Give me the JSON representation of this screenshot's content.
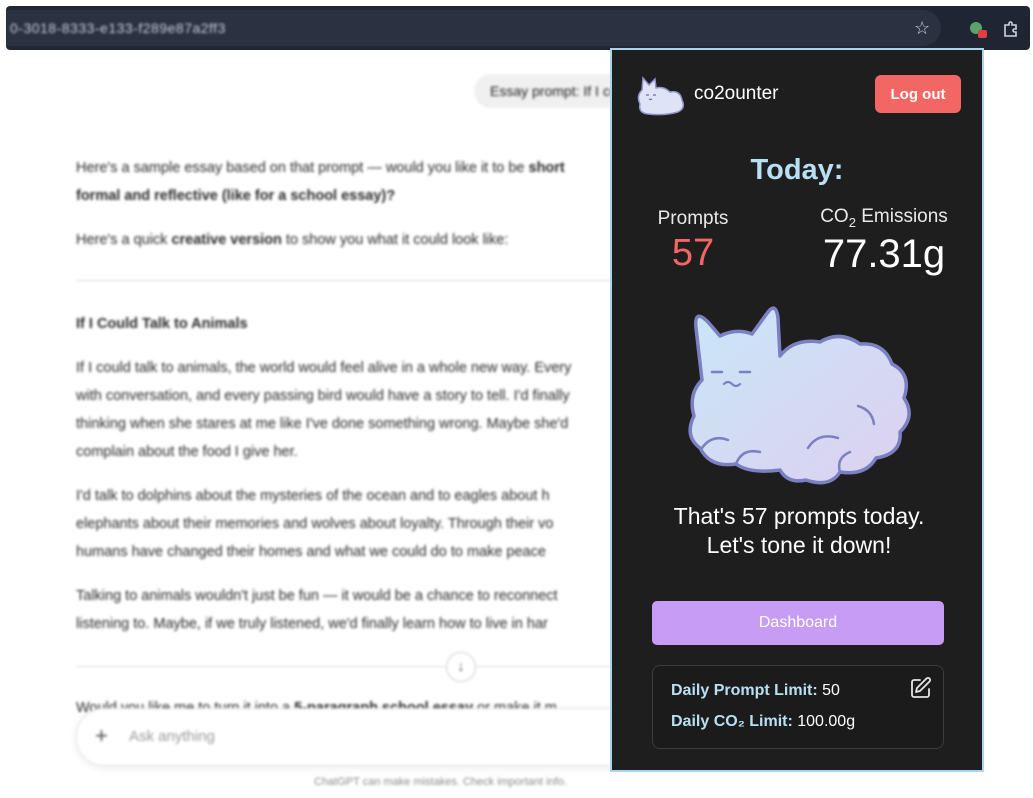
{
  "browser": {
    "url": "0-3018-8333-e133-f289e87a2ff3",
    "star_icon": "star-icon",
    "extension_icon": "cat-extension-icon",
    "extensions_menu_icon": "puzzle-icon"
  },
  "chat": {
    "user_prompt": "Essay prompt: If I could talk to animals",
    "intro_line1_a": "Here's a sample essay based on that prompt — would you like it to be ",
    "intro_line1_b": "short",
    "intro_line2": "formal and reflective (like for a school essay)?",
    "quick_a": "Here's a quick ",
    "quick_b": "creative version",
    "quick_c": " to show you what it could look like:",
    "essay_title": "If I Could Talk to Animals",
    "p1": [
      "If I could talk to animals, the world would feel alive in a whole new way. Every",
      "with conversation, and every passing bird would have a story to tell. I'd finally",
      "thinking when she stares at me like I've done something wrong. Maybe she'd",
      "complain about the food I give her."
    ],
    "p2": [
      "I'd talk to dolphins about the mysteries of the ocean and to eagles about h",
      "elephants about their memories and wolves about loyalty. Through their vo",
      "humans have changed their homes and what we could do to make peace"
    ],
    "p3": [
      "Talking to animals wouldn't just be fun — it would be a chance to reconnect",
      "listening to. Maybe, if we truly listened, we'd finally learn how to live in har"
    ],
    "followup_a": "Would you like me to turn it into a ",
    "followup_b": "5-paragraph school essay",
    "followup_c": " or make it m",
    "composer_placeholder": "Ask anything",
    "footnote": "ChatGPT can make mistakes. Check important info."
  },
  "popup": {
    "brand": "co2ounter",
    "logout_label": "Log out",
    "today_label": "Today:",
    "prompts_label": "Prompts",
    "prompts_value": "57",
    "co2_label_prefix": "CO",
    "co2_label_sub": "2",
    "co2_label_suffix": " Emissions",
    "co2_value": "77.31g",
    "message_line1": "That's 57 prompts today.",
    "message_line2": "Let's tone it down!",
    "dashboard_label": "Dashboard",
    "prompt_limit_label": "Daily Prompt Limit:",
    "prompt_limit_value": "50",
    "co2_limit_label": "Daily CO₂ Limit:",
    "co2_limit_value": "100.00g",
    "colors": {
      "background": "#1e1e1e",
      "accent_red": "#f26663",
      "accent_purple": "#c79cf5",
      "accent_blue": "#b8e0f2"
    }
  }
}
